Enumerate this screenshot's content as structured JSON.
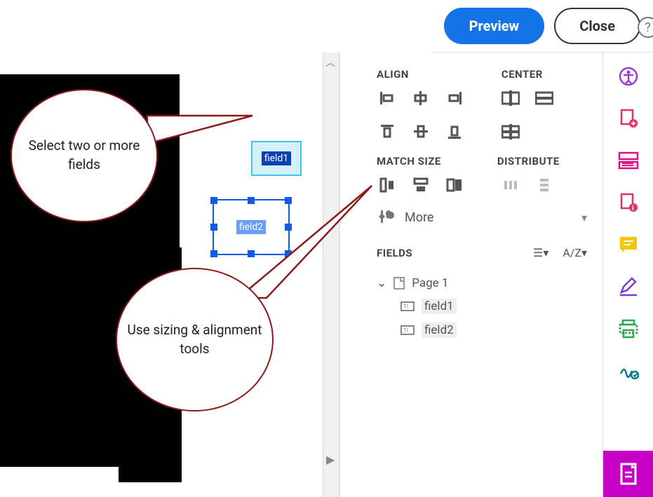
{
  "toolbar": {
    "help_tooltip": "Help",
    "preview_label": "Preview",
    "close_label": "Close"
  },
  "canvas": {
    "field1_label": "field1",
    "field2_label": "field2"
  },
  "callouts": {
    "select_fields": "Select two or more fields",
    "sizing_tools": "Use sizing & alignment tools"
  },
  "panel": {
    "align_title": "ALIGN",
    "center_title": "CENTER",
    "match_size_title": "MATCH SIZE",
    "distribute_title": "DISTRIBUTE",
    "more_label": "More",
    "fields_title": "FIELDS",
    "tree": {
      "page_label": "Page 1",
      "items": [
        "field1",
        "field2"
      ]
    }
  },
  "rail_icons": [
    "accessibility-icon",
    "add-pdf-icon",
    "organize-icon",
    "pdf-info-icon",
    "comment-icon",
    "edit-icon",
    "print-icon",
    "sign-icon",
    "prepare-form-icon"
  ],
  "colors": {
    "accent_blue": "#1473e6",
    "select_blue": "#0d5be6",
    "callout_border": "#8b1a1a",
    "active_magenta": "#c700c7"
  }
}
